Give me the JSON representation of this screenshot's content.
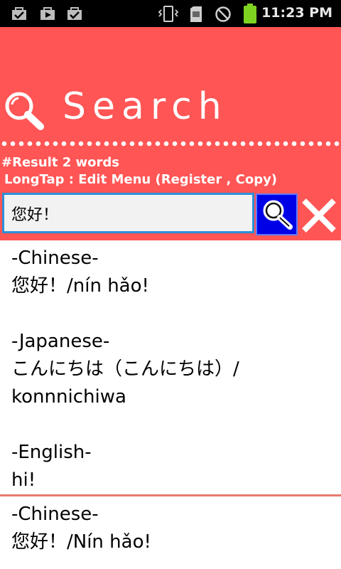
{
  "status_bar": {
    "time": "11:23 PM",
    "icons": [
      "bag-check-icon",
      "play-store-icon",
      "bag-check-icon",
      "vibrate-icon",
      "sd-card-icon",
      "no-signal-icon",
      "battery-icon"
    ]
  },
  "header": {
    "title": "Search",
    "result_count": "#Result 2 words",
    "hint": "LongTap : Edit Menu (Register , Copy)",
    "search_value": "您好！"
  },
  "colors": {
    "header_bg": "#ff5555",
    "search_button_bg": "#0000e6",
    "input_border": "#2a8fd8",
    "divider": "#e87a6e"
  },
  "results": [
    {
      "chinese_label": "-Chinese-",
      "chinese_text": "您好！/nín hǎo!",
      "japanese_label": "-Japanese-",
      "japanese_text": "こんにちは（こんにちは）/",
      "japanese_reading": "konnnichiwa",
      "english_label": "-English-",
      "english_text": "hi!"
    },
    {
      "chinese_label": "-Chinese-",
      "chinese_text": "您好！/Nín hǎo!"
    }
  ]
}
